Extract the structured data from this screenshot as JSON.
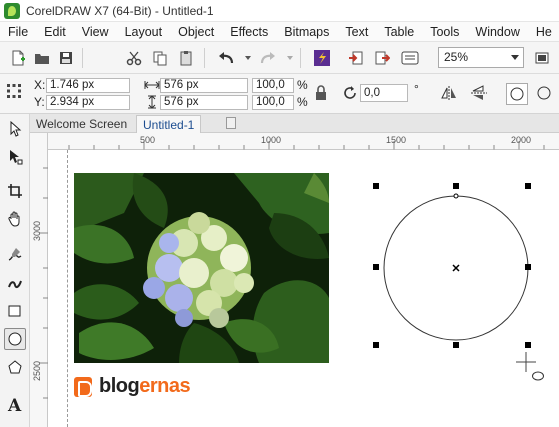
{
  "window": {
    "title": "CorelDRAW X7 (64-Bit) - Untitled-1"
  },
  "menu": [
    "File",
    "Edit",
    "View",
    "Layout",
    "Object",
    "Effects",
    "Bitmaps",
    "Text",
    "Table",
    "Tools",
    "Window",
    "He"
  ],
  "toolbar": {
    "zoom": "25%",
    "icons": [
      "new-document-icon",
      "open-icon",
      "save-icon",
      "cut-icon",
      "copy-icon",
      "paste-icon",
      "undo-icon",
      "redo-icon",
      "corel-connect-icon",
      "import-icon",
      "export-icon",
      "publish-pdf-icon"
    ]
  },
  "property_bar": {
    "x_label": "X:",
    "x_value": "1.746 px",
    "y_label": "Y:",
    "y_value": "2.934 px",
    "width": "576 px",
    "height": "576 px",
    "scale_x": "100,0",
    "scale_y": "100,0",
    "percent": "%",
    "rotation": "0,0",
    "degree": "°"
  },
  "tabs": [
    {
      "label": "Welcome Screen",
      "active": false
    },
    {
      "label": "Untitled-1",
      "active": true
    }
  ],
  "rulers": {
    "horizontal": [
      "500",
      "1000",
      "1500",
      "2000"
    ],
    "vertical": [
      "3000",
      "2500"
    ]
  },
  "tools": [
    "pick-tool-icon",
    "shape-tool-icon",
    "crop-tool-icon",
    "pan-tool-icon",
    "freehand-tool-icon",
    "artistic-media-icon",
    "rectangle-tool-icon",
    "ellipse-tool-icon",
    "polygon-tool-icon",
    "text-tool-icon"
  ],
  "logo": {
    "text_main": "blog",
    "text_accent": "ernas"
  },
  "colors": {
    "accent": "#f26a1b",
    "selection_handle": "#000000"
  }
}
